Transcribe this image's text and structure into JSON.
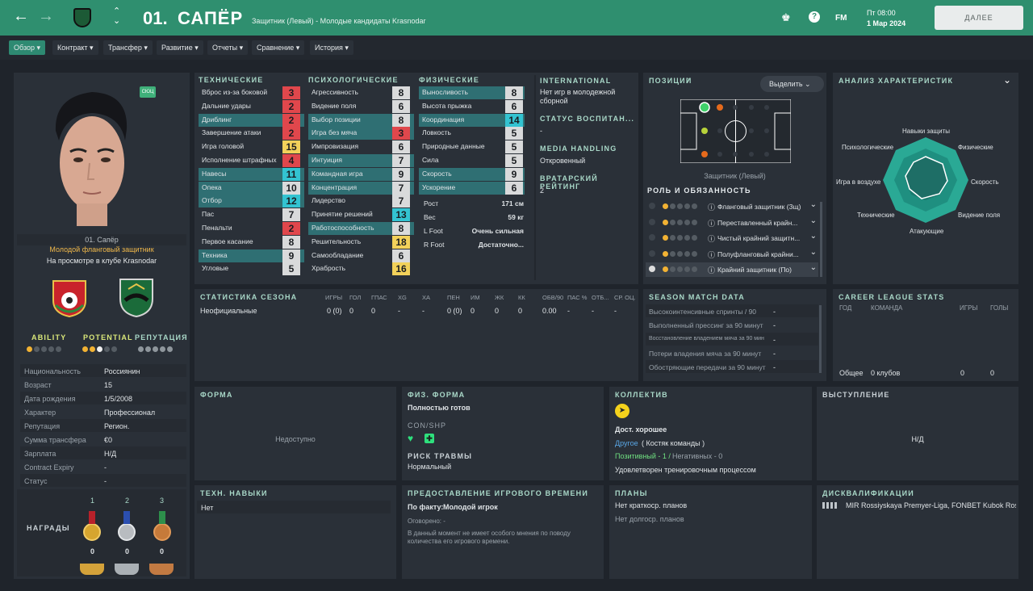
{
  "header": {
    "number": "01.",
    "name": "САПЁР",
    "subtitle": "Защитник (Левый) - Молодые кандидаты Krasnodar",
    "day": "Пт 08:00",
    "date": "1 Мар 2024",
    "continue": "ДАЛЕЕ",
    "fm": "FM"
  },
  "nav": [
    "Обзор",
    "Контракт",
    "Трансфер",
    "Развитие",
    "Отчеты",
    "Сравнение",
    "История"
  ],
  "profile": {
    "name": "01. Сапёр",
    "role": "Молодой фланговый защитник",
    "status": "На просмотре в клубе Krasnodar",
    "badge": "СЮЦ",
    "ability": "ABILITY",
    "potential": "POTENTIAL",
    "reputation": "РЕПУТАЦИЯ",
    "info": [
      [
        "Национальность",
        "Россиянин"
      ],
      [
        "Возраст",
        "15"
      ],
      [
        "Дата рождения",
        "1/5/2008"
      ],
      [
        "Характер",
        "Профессионал"
      ],
      [
        "Репутация",
        "Регион."
      ],
      [
        "Сумма трансфера",
        "€0"
      ],
      [
        "Зарплата",
        "Н/Д"
      ],
      [
        "Contract Expiry",
        "-"
      ],
      [
        "Статус",
        "-"
      ]
    ],
    "awards_label": "НАГРАДЫ",
    "awards": [
      {
        "rank": "1",
        "count": "0"
      },
      {
        "rank": "2",
        "count": "0"
      },
      {
        "rank": "3",
        "count": "0"
      }
    ]
  },
  "attributes": {
    "tech_title": "ТЕХНИЧЕСКИЕ",
    "mental_title": "ПСИХОЛОГИЧЕСКИЕ",
    "phys_title": "ФИЗИЧЕСКИЕ",
    "technical": [
      [
        "Вброс из-за боковой",
        "3",
        0
      ],
      [
        "Дальние удары",
        "2",
        0
      ],
      [
        "Дриблинг",
        "2",
        1
      ],
      [
        "Завершение атаки",
        "2",
        0
      ],
      [
        "Игра головой",
        "15",
        0
      ],
      [
        "Исполнение штрафных",
        "4",
        0
      ],
      [
        "Навесы",
        "11",
        1
      ],
      [
        "Опека",
        "10",
        1
      ],
      [
        "Отбор",
        "12",
        1
      ],
      [
        "Пас",
        "7",
        0
      ],
      [
        "Пенальти",
        "2",
        0
      ],
      [
        "Первое касание",
        "8",
        0
      ],
      [
        "Техника",
        "9",
        1
      ],
      [
        "Угловые",
        "5",
        0
      ]
    ],
    "mental": [
      [
        "Агрессивность",
        "8",
        0
      ],
      [
        "Видение поля",
        "6",
        0
      ],
      [
        "Выбор позиции",
        "8",
        1
      ],
      [
        "Игра без мяча",
        "3",
        1
      ],
      [
        "Импровизация",
        "6",
        0
      ],
      [
        "Интуиция",
        "7",
        1
      ],
      [
        "Командная игра",
        "9",
        1
      ],
      [
        "Концентрация",
        "7",
        1
      ],
      [
        "Лидерство",
        "7",
        0
      ],
      [
        "Принятие решений",
        "13",
        0
      ],
      [
        "Работоспособность",
        "8",
        1
      ],
      [
        "Решительность",
        "18",
        0
      ],
      [
        "Самообладание",
        "6",
        0
      ],
      [
        "Храбрость",
        "16",
        0
      ]
    ],
    "physical": [
      [
        "Выносливость",
        "8",
        1
      ],
      [
        "Высота прыжка",
        "6",
        0
      ],
      [
        "Координация",
        "14",
        1
      ],
      [
        "Ловкость",
        "5",
        0
      ],
      [
        "Природные данные",
        "5",
        0
      ],
      [
        "Сила",
        "5",
        0
      ],
      [
        "Скорость",
        "9",
        1
      ],
      [
        "Ускорение",
        "6",
        1
      ]
    ],
    "extra": [
      [
        "Рост",
        "171 см"
      ],
      [
        "Вес",
        "59 кг"
      ],
      [
        "L Foot",
        "Очень сильная"
      ],
      [
        "R Foot",
        "Достаточно..."
      ]
    ]
  },
  "intl": {
    "title": "INTERNATIONAL",
    "text": "Нет игр в молодежной сборной",
    "edu_title": "СТАТУС ВОСПИТАН...",
    "edu": "-",
    "media_title": "MEDIA HANDLING",
    "media": "Откровенный",
    "gk_title": "ВРАТАРСКИЙ РЕЙТИНГ",
    "gk": "2"
  },
  "positions": {
    "title": "ПОЗИЦИИ",
    "select": "Выделить",
    "pos_label": "Защитник (Левый)",
    "roles_title": "РОЛЬ И ОБЯЗАННОСТЬ",
    "roles": [
      "Фланговый защитник (Зщ)",
      "Переставленный крайн...",
      "Чистый крайний защитн...",
      "Полуфланговый крайни...",
      "Крайний защитник (По)"
    ]
  },
  "analysis": {
    "title": "АНАЛИЗ ХАРАКТЕРИСТИК",
    "labels": [
      "Навыки защиты",
      "Физические",
      "Скорость",
      "Видение поля",
      "Атакующие",
      "Технические",
      "Игра в воздухе",
      "Психологические"
    ]
  },
  "season": {
    "title": "СТАТИСТИКА СЕЗОНА",
    "headers": [
      "ИГРЫ",
      "ГОЛ",
      "ГПАС",
      "XG",
      "XA",
      "ПЕН",
      "ИМ",
      "ЖК",
      "КК",
      "ОБВ/90",
      "ПАС %",
      "ОТБ...",
      "СР. ОЦ."
    ],
    "row_label": "Неофициальные",
    "row": [
      "0 (0)",
      "0",
      "0",
      "-",
      "-",
      "0 (0)",
      "0",
      "0",
      "0",
      "0.00",
      "-",
      "-",
      "-"
    ]
  },
  "match": {
    "title": "SEASON MATCH DATA",
    "rows": [
      [
        "Высокоинтенсивные спринты / 90",
        "-"
      ],
      [
        "Выполненный прессинг за 90 минут",
        "-"
      ],
      [
        "Восстановление владением мяча за 90 мин",
        "-"
      ],
      [
        "Потери владения мяча за 90 минут",
        "-"
      ],
      [
        "Обостряющие передачи за 90 минут",
        "-"
      ]
    ]
  },
  "career": {
    "title": "CAREER LEAGUE STATS",
    "headers": [
      "ГОД",
      "КОМАНДА",
      "ИГРЫ",
      "ГОЛЫ"
    ],
    "total": "Общее",
    "clubs": "0 клубов",
    "games": "0",
    "goals": "0"
  },
  "form": {
    "title": "ФОРМА",
    "text": "Недоступно"
  },
  "fitness": {
    "title": "ФИЗ. ФОРМА",
    "state": "Полностью готов",
    "con": "CON/SHP",
    "injury_title": "РИСК ТРАВМЫ",
    "injury": "Нормальный"
  },
  "team": {
    "title": "КОЛЛЕКТИВ",
    "rel": "Дост. хорошее",
    "others": "Другое",
    "others2": "( Костяк команды )",
    "pos": "Позитивный - 1 /",
    "neg": "Негативных - 0",
    "training": "Удовлетворен тренировочным процессом"
  },
  "perf": {
    "title": "ВЫСТУПЛЕНИЕ",
    "text": "Н/Д"
  },
  "traits": {
    "title": "ТЕХН. НАВЫКИ",
    "text": "Нет"
  },
  "playtime": {
    "title": "ПРЕДОСТАВЛЕНИЕ ИГРОВОГО ВРЕМЕНИ",
    "fact": "По факту:",
    "fact_val": "Молодой игрок",
    "agreed": "Оговорено: -",
    "note": "В данный момент не имеет особого мнения по поводу количества его игрового времени."
  },
  "plans": {
    "title": "ПЛАНЫ",
    "short": "Нет краткоср. планов",
    "long": "Нет долгоср. планов"
  },
  "bans": {
    "title": "ДИСКВАЛИФИКАЦИИ",
    "text": "MIR Rossiyskaya Premyer-Liga, FONBET Kubok Rossii"
  },
  "colors": {
    "header": "#2f8f6f",
    "panel": "#2a3038",
    "highlight": "#2f6f73"
  }
}
